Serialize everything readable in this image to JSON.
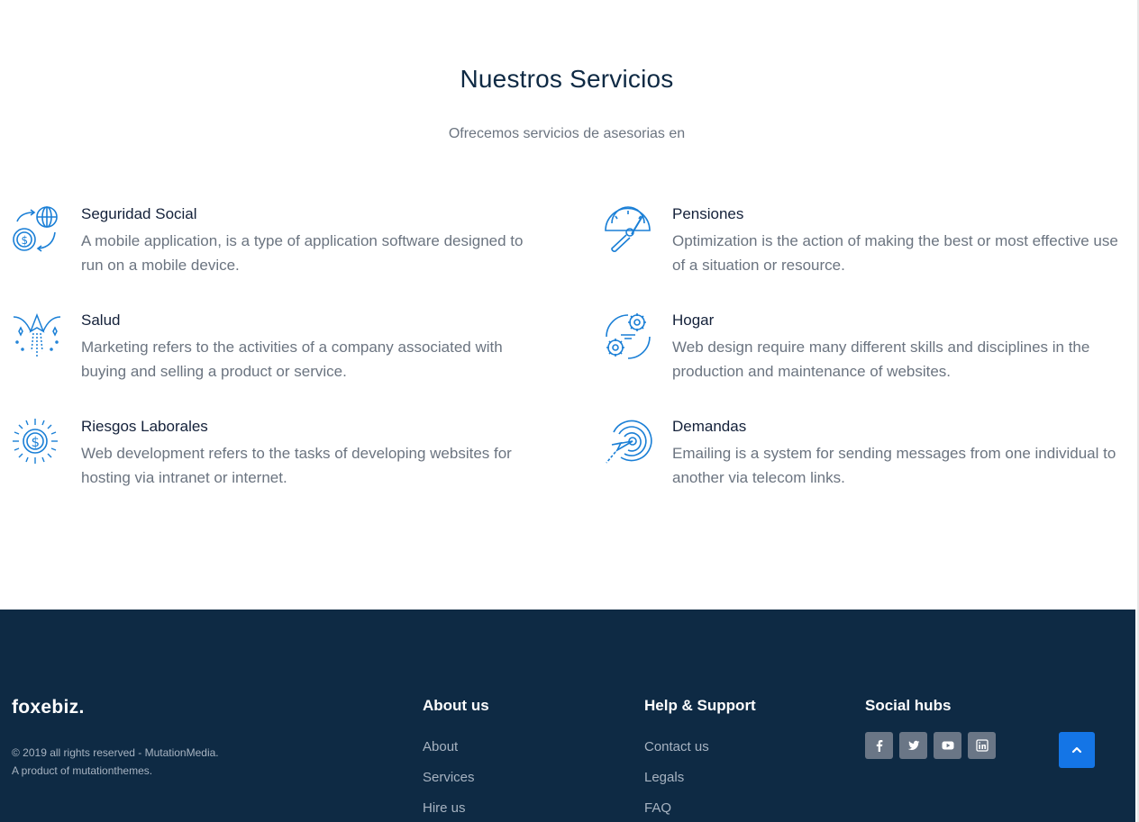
{
  "section": {
    "title": "Nuestros Servicios",
    "subtitle": "Ofrecemos servicios de asesorias en"
  },
  "services": [
    {
      "name": "Seguridad Social",
      "desc": "A mobile application, is a type of application software designed to run on a mobile device.",
      "icon": "globe-money-icon"
    },
    {
      "name": "Pensiones",
      "desc": "Optimization is the action of making the best or most effective use of a situation or resource.",
      "icon": "speedometer-icon"
    },
    {
      "name": "Salud",
      "desc": "Marketing refers to the activities of a company associated with buying and selling a product or service.",
      "icon": "rocket-stars-icon"
    },
    {
      "name": "Hogar",
      "desc": "Web design require many different skills and disciplines in the production and maintenance of websites.",
      "icon": "gears-icon"
    },
    {
      "name": "Riesgos Laborales",
      "desc": "Web development refers to the tasks of developing websites for hosting via intranet or internet.",
      "icon": "dollar-burst-icon"
    },
    {
      "name": "Demandas",
      "desc": "Emailing is a system for sending messages from one individual to another via telecom links.",
      "icon": "target-arrow-icon"
    }
  ],
  "footer": {
    "brand": "foxebiz.",
    "copyright_line1": "© 2019 all rights reserved - MutationMedia.",
    "copyright_line2": "A product of mutationthemes.",
    "about": {
      "title": "About us",
      "links": [
        "About",
        "Services",
        "Hire us"
      ]
    },
    "help": {
      "title": "Help & Support",
      "links": [
        "Contact us",
        "Legals",
        "FAQ"
      ]
    },
    "social": {
      "title": "Social hubs",
      "icons": [
        "facebook-icon",
        "twitter-icon",
        "youtube-icon",
        "linkedin-icon"
      ]
    }
  },
  "colors": {
    "accent": "#1475e6",
    "footer_bg": "#0e2a44",
    "title": "#0f2a44",
    "body_text": "#6b7480"
  }
}
